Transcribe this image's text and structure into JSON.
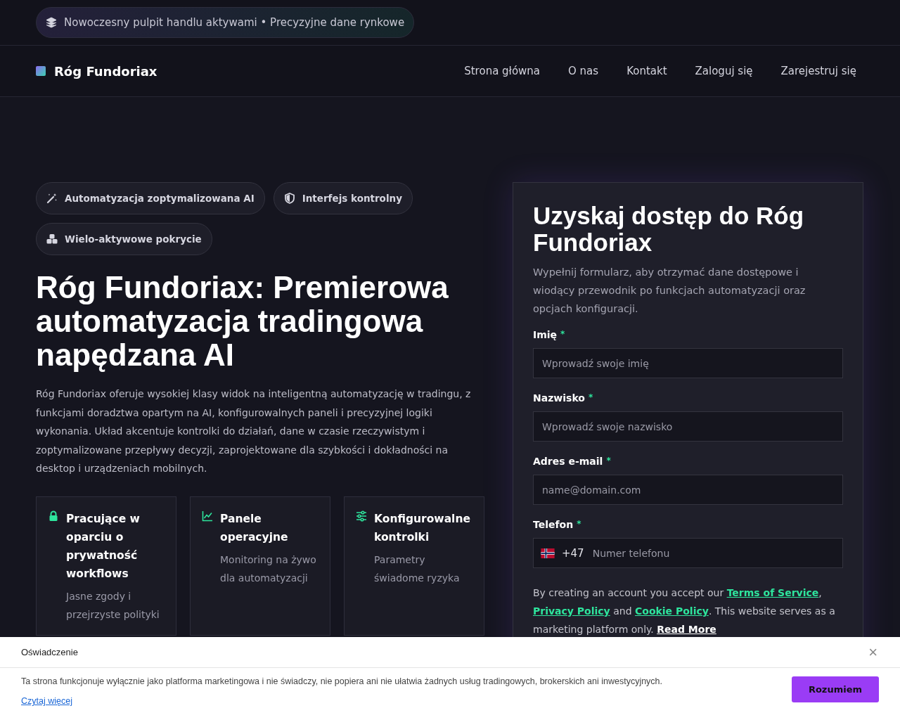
{
  "announcement": {
    "text": "Nowoczesny pulpit handlu aktywami • Precyzyjne dane rynkowe"
  },
  "brand": {
    "name": "Róg Fundoriax"
  },
  "nav": [
    {
      "label": "Strona główna"
    },
    {
      "label": "O nas"
    },
    {
      "label": "Kontakt"
    },
    {
      "label": "Zaloguj się"
    },
    {
      "label": "Zarejestruj się"
    }
  ],
  "badges": [
    {
      "kind": "wand",
      "label": "Automatyzacja zoptymalizowana AI"
    },
    {
      "kind": "shield",
      "label": "Interfejs kontrolny"
    },
    {
      "kind": "cubes",
      "label": "Wielo-aktywowe pokrycie"
    }
  ],
  "hero": {
    "title": "Róg Fundoriax: Premierowa automatyzacja tradingowa napędzana AI",
    "text": "Róg Fundoriax oferuje wysokiej klasy widok na inteligentną automatyzację w tradingu, z funkcjami doradztwa opartym na AI, konfigurowalnych paneli i precyzyjnej logiki wykonania. Układ akcentuje kontrolki do działań, dane w czasie rzeczywistym i zoptymalizowane przepływy decyzji, zaprojektowane dla szybkości i dokładności na desktop i urządzeniach mobilnych."
  },
  "features": [
    {
      "kind": "lock",
      "title": "Pracujące w oparciu o prywatność workflows",
      "text": "Jasne zgody i przejrzyste polityki"
    },
    {
      "kind": "chart",
      "title": "Panele operacyjne",
      "text": "Monitoring na żywo dla automatyzacji"
    },
    {
      "kind": "sliders",
      "title": "Konfigurowalne kontrolki",
      "text": "Parametry świadome ryzyka"
    }
  ],
  "form": {
    "title": "Uzyskaj dostęp do Róg Fundoriax",
    "text": "Wypełnij formularz, aby otrzymać dane dostępowe i wiodący przewodnik po funkcjach automatyzacji oraz opcjach konfiguracji.",
    "fields": [
      {
        "kind": "text",
        "label": "Imię",
        "mark": "*",
        "placeholder": "Wprowadź swoje imię"
      },
      {
        "kind": "text",
        "label": "Nazwisko",
        "mark": "*",
        "placeholder": "Wprowadź swoje nazwisko"
      },
      {
        "kind": "text",
        "label": "Adres e-mail",
        "mark": "*",
        "placeholder": "name@domain.com"
      },
      {
        "kind": "phone",
        "label": "Telefon",
        "mark": "*",
        "code": "+47",
        "placeholder": "Numer telefonu"
      }
    ],
    "terms": [
      {
        "kind": "text",
        "text": "By creating an account you accept our "
      },
      {
        "kind": "link",
        "text": "Terms of Service"
      },
      {
        "kind": "text",
        "text": ", "
      },
      {
        "kind": "link",
        "text": "Privacy Policy"
      },
      {
        "kind": "text",
        "text": " and "
      },
      {
        "kind": "link",
        "text": "Cookie Policy"
      },
      {
        "kind": "text",
        "text": ". This website serves as a marketing platform only. "
      },
      {
        "kind": "more",
        "text": "Read More"
      }
    ]
  },
  "notice": {
    "title": "Oświadczenie",
    "close": "×",
    "text": "Ta strona funkcjonuje wyłącznie jako platforma marketingowa i nie świadczy, nie popiera ani nie ułatwia żadnych usług tradingowych, brokerskich ani inwestycyjnych.",
    "link": "Czytaj więcej",
    "button": "Rozumiem"
  }
}
